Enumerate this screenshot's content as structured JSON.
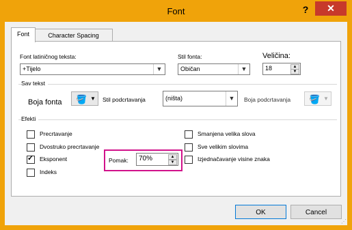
{
  "window": {
    "title": "Font",
    "help": "?",
    "close": "✕"
  },
  "tabs": [
    "Font",
    "Character Spacing"
  ],
  "font_section": {
    "latin_label": "Font latiničnog teksta:",
    "latin_value": "+Tijelo",
    "style_label": "Stil fonta:",
    "style_value": "Običan",
    "size_label": "Veličina:",
    "size_value": "18"
  },
  "all_text": {
    "section_label": "Sav tekst",
    "font_color_label": "Boja fonta",
    "underline_style_label": "Stil podcrtavanja",
    "underline_style_value": "(ništa)",
    "underline_color_label": "Boja podcrtavanja"
  },
  "effects": {
    "section_label": "Efekti",
    "left": [
      {
        "label": "Precrtavanje",
        "checked": false
      },
      {
        "label": "Dvostruko precrtavanje",
        "checked": false
      },
      {
        "label": "Eksponent",
        "checked": true
      },
      {
        "label": "Indeks",
        "checked": false
      }
    ],
    "right": [
      {
        "label": "Smanjena velika slova",
        "checked": false
      },
      {
        "label": "Sve velikim slovima",
        "checked": false
      },
      {
        "label": "Izjednačavanje visine znaka",
        "checked": false
      }
    ],
    "offset_label": "Pomak:",
    "offset_value": "70%"
  },
  "footer": {
    "ok": "OK",
    "cancel": "Cancel"
  },
  "colors": {
    "titlebar": "#f0a30a",
    "close": "#c7392b",
    "highlight": "#d1118a"
  }
}
